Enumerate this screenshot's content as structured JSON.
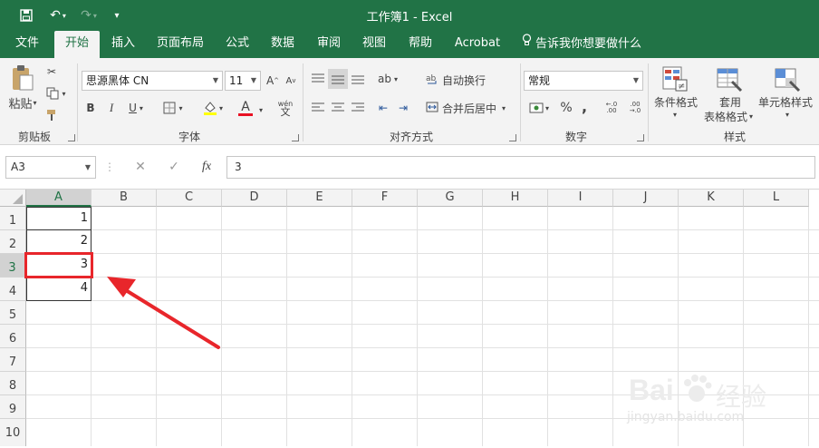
{
  "title": "工作簿1  -  Excel",
  "tabs": [
    "文件",
    "开始",
    "插入",
    "页面布局",
    "公式",
    "数据",
    "审阅",
    "视图",
    "帮助",
    "Acrobat"
  ],
  "tell_me": "告诉我你想要做什么",
  "ribbon": {
    "paste": "粘贴",
    "clipboard": "剪贴板",
    "font_name": "思源黑体 CN",
    "font_size": "11",
    "font_group": "字体",
    "bold": "B",
    "italic": "I",
    "underline": "U",
    "font_color_letter": "A",
    "wen": "wén",
    "wrap": "自动换行",
    "merge": "合并后居中",
    "align_group": "对齐方式",
    "number_format": "常规",
    "percent": "%",
    "comma": ",",
    "number_group": "数字",
    "cond_format": "条件格式",
    "table_fmt_1": "套用",
    "table_fmt_2": "表格格式",
    "cell_style": "单元格样式",
    "style_group": "样式"
  },
  "namebox": "A3",
  "formula_value": "3",
  "columns": [
    "A",
    "B",
    "C",
    "D",
    "E",
    "F",
    "G",
    "H",
    "I",
    "J",
    "K",
    "L"
  ],
  "rows": [
    "1",
    "2",
    "3",
    "4",
    "5",
    "6",
    "7",
    "8",
    "9",
    "10"
  ],
  "cells": [
    "1",
    "2",
    "3",
    "4"
  ],
  "watermark": {
    "logo": "Bai",
    "brand": "经验",
    "url": "jingyan.baidu.com"
  },
  "colors": {
    "excel_green": "#217346",
    "annotation_red": "#e8262b"
  }
}
